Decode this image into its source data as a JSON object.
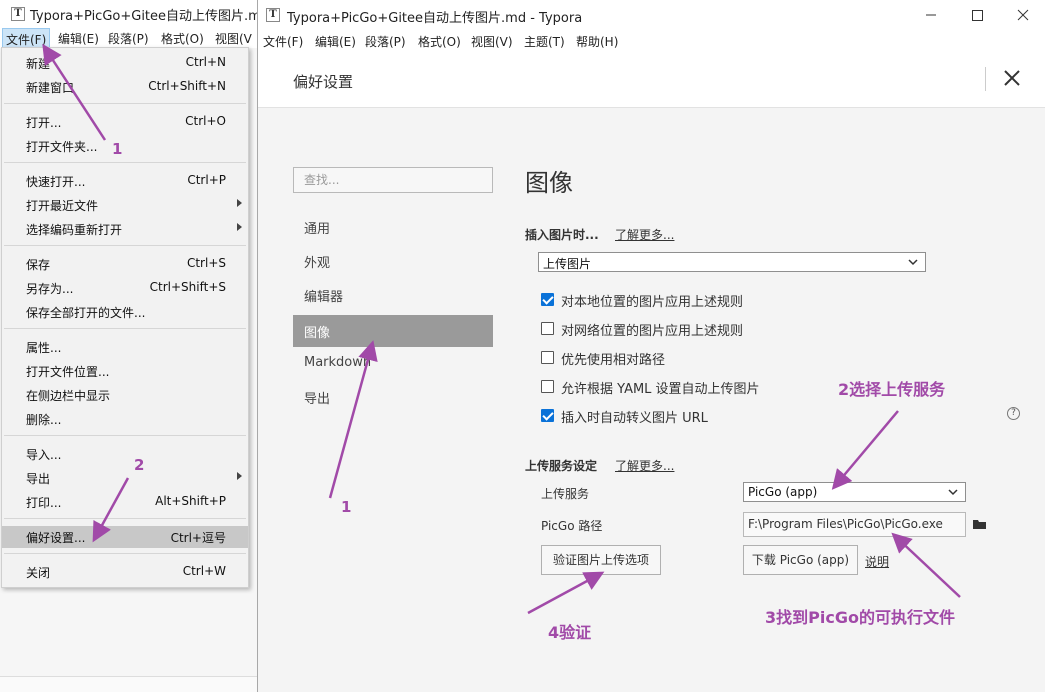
{
  "background_window": {
    "title": "Typora+PicGo+Gitee自动上传图片.md -",
    "menus": [
      "文件(F)",
      "编辑(E)",
      "段落(P)",
      "格式(O)",
      "视图(V"
    ]
  },
  "file_menu": {
    "items": [
      {
        "label": "新建",
        "shortcut": "Ctrl+N"
      },
      {
        "label": "新建窗口",
        "shortcut": "Ctrl+Shift+N"
      },
      {
        "label": "打开...",
        "shortcut": "Ctrl+O"
      },
      {
        "label": "打开文件夹...",
        "shortcut": ""
      },
      {
        "label": "快速打开...",
        "shortcut": "Ctrl+P"
      },
      {
        "label": "打开最近文件",
        "shortcut": ""
      },
      {
        "label": "选择编码重新打开",
        "shortcut": ""
      },
      {
        "label": "保存",
        "shortcut": "Ctrl+S"
      },
      {
        "label": "另存为...",
        "shortcut": "Ctrl+Shift+S"
      },
      {
        "label": "保存全部打开的文件...",
        "shortcut": ""
      },
      {
        "label": "属性...",
        "shortcut": ""
      },
      {
        "label": "打开文件位置...",
        "shortcut": ""
      },
      {
        "label": "在侧边栏中显示",
        "shortcut": ""
      },
      {
        "label": "删除...",
        "shortcut": ""
      },
      {
        "label": "导入...",
        "shortcut": ""
      },
      {
        "label": "导出",
        "shortcut": ""
      },
      {
        "label": "打印...",
        "shortcut": "Alt+Shift+P"
      },
      {
        "label": "偏好设置...",
        "shortcut": "Ctrl+逗号"
      },
      {
        "label": "关闭",
        "shortcut": "Ctrl+W"
      }
    ]
  },
  "main_window": {
    "title": "Typora+PicGo+Gitee自动上传图片.md - Typora",
    "menus": [
      "文件(F)",
      "编辑(E)",
      "段落(P)",
      "格式(O)",
      "视图(V)",
      "主题(T)",
      "帮助(H)"
    ]
  },
  "preferences": {
    "title": "偏好设置",
    "search_placeholder": "查找...",
    "nav": [
      "通用",
      "外观",
      "编辑器",
      "图像",
      "Markdown",
      "导出"
    ],
    "active_nav": "图像",
    "section_title": "图像",
    "insert_heading": "插入图片时...",
    "learn_more": "了解更多...",
    "insert_action": "上传图片",
    "checkboxes": [
      {
        "label": "对本地位置的图片应用上述规则",
        "checked": true
      },
      {
        "label": "对网络位置的图片应用上述规则",
        "checked": false
      },
      {
        "label": "优先使用相对路径",
        "checked": false
      },
      {
        "label": "允许根据 YAML 设置自动上传图片",
        "checked": false
      },
      {
        "label": "插入时自动转义图片 URL",
        "checked": true
      }
    ],
    "help_icon_text": "?",
    "upload_heading": "上传服务设定",
    "upload_learn_more": "了解更多...",
    "upload_service_label": "上传服务",
    "upload_service_value": "PicGo (app)",
    "picgo_path_label": "PicGo 路径",
    "picgo_path_value": "F:\\Program Files\\PicGo\\PicGo.exe",
    "verify_button": "验证图片上传选项",
    "download_button": "下载 PicGo (app)",
    "explain_link": "说明"
  },
  "annotations": {
    "menu_step1": "1",
    "menu_step2": "2",
    "nav_step1": "1",
    "service_step2": "2选择上传服务",
    "path_step3": "3找到PicGo的可执行文件",
    "verify_step4": "4验证",
    "color": "#a14aa8"
  }
}
